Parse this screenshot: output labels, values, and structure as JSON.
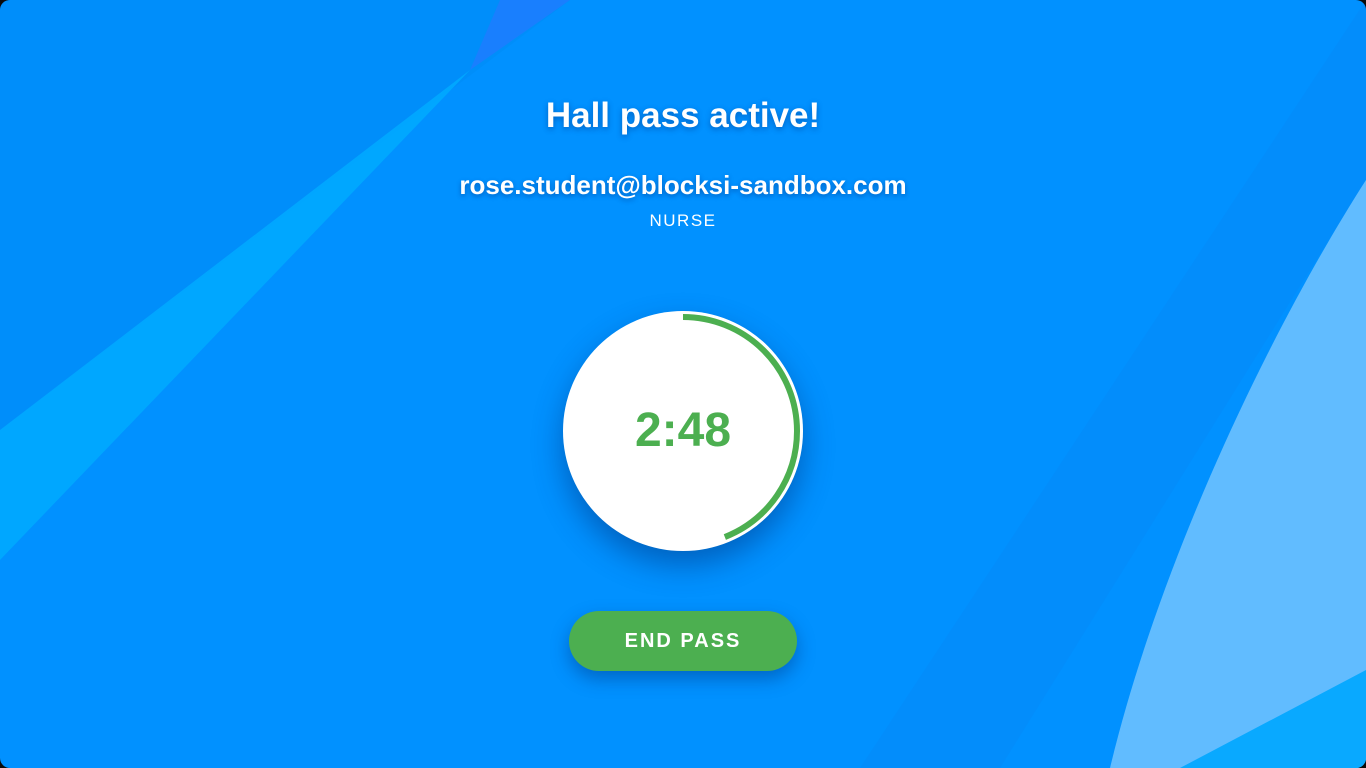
{
  "pass": {
    "title": "Hall pass active!",
    "email": "rose.student@blocksi-sandbox.com",
    "destination": "NURSE"
  },
  "timer": {
    "display": "2:48",
    "progress_remaining": 0.44,
    "color": "#4caf50"
  },
  "actions": {
    "end_label": "END PASS"
  },
  "colors": {
    "background": "#0191ff",
    "accent": "#4caf50",
    "text": "#ffffff"
  }
}
